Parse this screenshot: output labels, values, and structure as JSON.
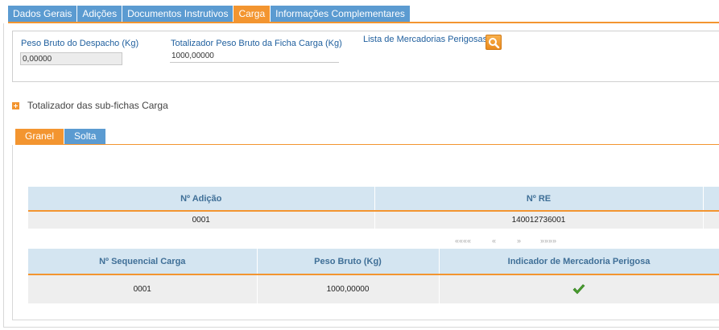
{
  "top_tabs": [
    {
      "label": "Dados Gerais"
    },
    {
      "label": "Adições"
    },
    {
      "label": "Documentos Instrutivos"
    },
    {
      "label": "Carga"
    },
    {
      "label": "Informações Complementares"
    }
  ],
  "active_top_tab": "Carga",
  "fields": {
    "peso_bruto_despacho": {
      "label": "Peso Bruto do Despacho (Kg)",
      "value": "0,00000"
    },
    "totalizador_peso": {
      "label": "Totalizador Peso Bruto da Ficha Carga (Kg)",
      "value": "1000,00000"
    },
    "lista_mercadorias": {
      "label": "Lista de Mercadorias Perigosas"
    }
  },
  "totalizador": {
    "label": "Totalizador das sub-fichas Carga"
  },
  "sub_tabs": [
    {
      "label": "Granel"
    },
    {
      "label": "Solta"
    }
  ],
  "table_adicao": {
    "headers": [
      "Nº Adição",
      "Nº RE"
    ],
    "rows": [
      [
        "0001",
        "140012736001"
      ]
    ]
  },
  "pager": {
    "first": "««««",
    "prev": "«",
    "next": "»",
    "last": "»»»»"
  },
  "table_carga": {
    "headers": [
      "Nº Sequencial Carga",
      "Peso Bruto (Kg)",
      "Indicador de Mercadoria Perigosa"
    ],
    "rows": [
      [
        "0001",
        "1000,00000",
        "check-icon"
      ]
    ]
  },
  "colors": {
    "accent": "#f39530",
    "tab_blue": "#5b9bd1",
    "header_bg": "#d4e5f1",
    "check_green": "#4a9e2f"
  }
}
